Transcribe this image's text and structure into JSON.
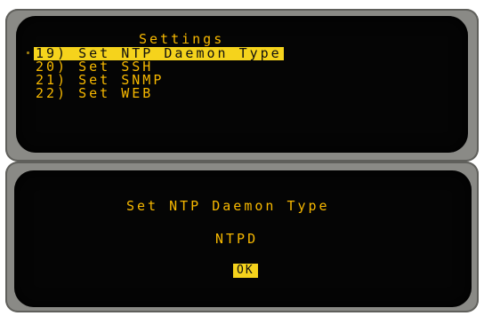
{
  "settings_screen": {
    "title": "Settings",
    "menu": [
      {
        "label": "19) Set NTP Daemon Type",
        "selected": true
      },
      {
        "label": "20) Set SSH",
        "selected": false
      },
      {
        "label": "21) Set SNMP",
        "selected": false
      },
      {
        "label": "22) Set WEB",
        "selected": false
      }
    ]
  },
  "dialog_screen": {
    "title": "Set NTP Daemon Type",
    "value": "NTPD",
    "ok_label": "OK"
  },
  "colors": {
    "lcd_text": "#f7b800",
    "highlight": "#f5d31c",
    "screen_bg": "#050505"
  }
}
